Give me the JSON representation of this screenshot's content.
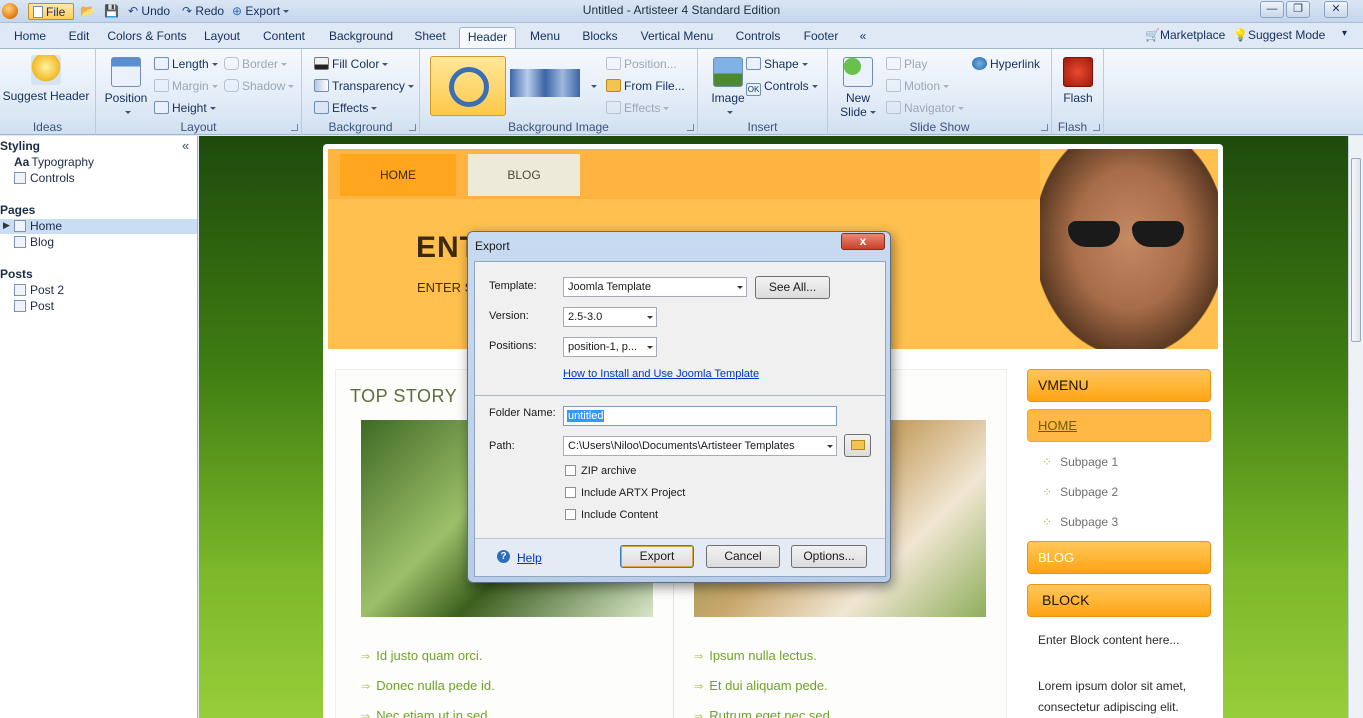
{
  "titlebar": {
    "file_label": "File",
    "undo_label": "Undo",
    "redo_label": "Redo",
    "export_label": "Export",
    "title": "Untitled - Artisteer 4 Standard Edition"
  },
  "ribbon_tabs": [
    "Home",
    "Edit",
    "Colors & Fonts",
    "Layout",
    "Content",
    "Background",
    "Sheet",
    "Header",
    "Menu",
    "Blocks",
    "Vertical Menu",
    "Controls",
    "Footer",
    "«"
  ],
  "active_tab": "Header",
  "ribbon_right": {
    "marketplace": "Marketplace",
    "suggest_mode": "Suggest Mode"
  },
  "ribbon": {
    "ideas": {
      "title": "Ideas",
      "suggest_header": "Suggest Header"
    },
    "layout": {
      "title": "Layout",
      "position": "Position",
      "length": "Length",
      "margin": "Margin",
      "height": "Height",
      "border": "Border",
      "shadow": "Shadow"
    },
    "background": {
      "title": "Background",
      "fill_color": "Fill Color",
      "transparency": "Transparency",
      "effects": "Effects"
    },
    "background_image": {
      "title": "Background Image",
      "position": "Position...",
      "from_file": "From File...",
      "effects": "Effects"
    },
    "insert": {
      "title": "Insert",
      "image": "Image",
      "shape": "Shape",
      "controls": "Controls"
    },
    "slideshow": {
      "title": "Slide Show",
      "new_slide": "New",
      "new_slide2": "Slide",
      "play": "Play",
      "motion": "Motion",
      "navigator": "Navigator",
      "hyperlink": "Hyperlink"
    },
    "flash": {
      "title": "Flash",
      "flash": "Flash"
    }
  },
  "left_panel": {
    "styling": "Styling",
    "typography": "Typography",
    "typography_prefix": "Aa",
    "controls": "Controls",
    "pages": "Pages",
    "home": "Home",
    "blog": "Blog",
    "posts": "Posts",
    "post2": "Post 2",
    "post": "Post",
    "collapse": "«"
  },
  "preview": {
    "menu": [
      "HOME",
      "BLOG"
    ],
    "site_title": "ENTER SITE TITLE",
    "site_title_visible": "ENT",
    "site_slogan": "ENTER S",
    "post_title": "TOP STORY",
    "left_bullets": [
      "Id justo quam orci.",
      "Donec nulla pede id.",
      "Nec etiam ut in sed."
    ],
    "right_bullets": [
      "Ipsum nulla lectus.",
      "Et dui aliquam pede.",
      "Rutrum eget nec sed."
    ],
    "vmenu_title": "VMENU",
    "vmenu_home": "HOME",
    "subpages": [
      "Subpage 1",
      "Subpage 2",
      "Subpage 3"
    ],
    "vmenu_blog": "BLOG",
    "block_title": "BLOCK",
    "block_text1": "Enter Block content here...",
    "block_text2": "Lorem ipsum dolor sit amet, consectetur adipiscing elit."
  },
  "dialog": {
    "title": "Export",
    "close": "x",
    "template_label": "Template:",
    "template_value": "Joomla Template",
    "see_all": "See All...",
    "version_label": "Version:",
    "version_value": "2.5-3.0",
    "positions_label": "Positions:",
    "positions_value": "position-1, p...",
    "install_link": "How to Install and Use Joomla Template",
    "folder_label": "Folder Name:",
    "folder_value": "untitled",
    "path_label": "Path:",
    "path_value": "C:\\Users\\Niloo\\Documents\\Artisteer Templates",
    "zip": "ZIP archive",
    "artx": "Include ARTX Project",
    "include_content": "Include Content",
    "help": "Help",
    "export_btn": "Export",
    "cancel_btn": "Cancel",
    "options_btn": "Options..."
  }
}
